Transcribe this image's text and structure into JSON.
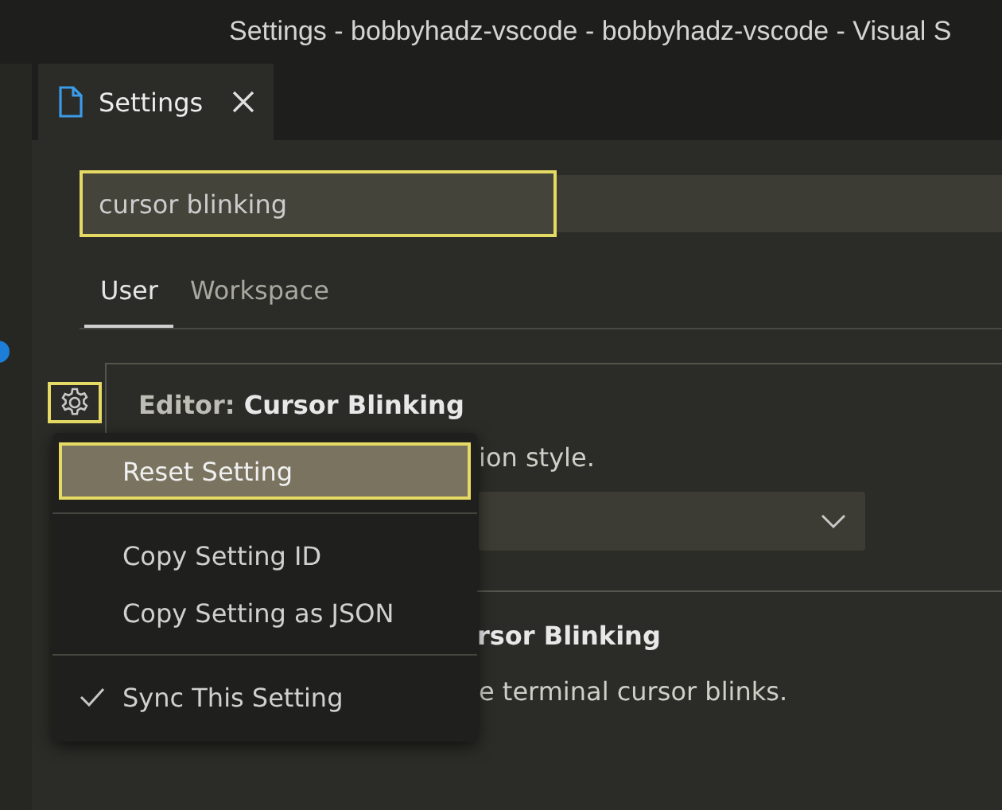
{
  "window": {
    "title": "Settings - bobbyhadz-vscode - bobbyhadz-vscode - Visual S"
  },
  "tabs": [
    {
      "label": "Settings",
      "selected": true
    }
  ],
  "search": {
    "value": "cursor blinking"
  },
  "scope_tabs": [
    {
      "label": "User",
      "selected": true
    },
    {
      "label": "Workspace",
      "selected": false
    }
  ],
  "settings": [
    {
      "category": "Editor:",
      "title": "Cursor Blinking",
      "description": "ion style.",
      "focused": true,
      "dropdown": true
    },
    {
      "title": "rsor Blinking",
      "description": "e terminal cursor blinks.",
      "focused": false,
      "dropdown": false
    }
  ],
  "context_menu": {
    "items": [
      {
        "kind": "item",
        "label": "Reset Setting",
        "selected": true,
        "checked": false
      },
      {
        "kind": "separator"
      },
      {
        "kind": "item",
        "label": "Copy Setting ID",
        "selected": false,
        "checked": false
      },
      {
        "kind": "item",
        "label": "Copy Setting as JSON",
        "selected": false,
        "checked": false
      },
      {
        "kind": "separator"
      },
      {
        "kind": "item",
        "label": "Sync This Setting",
        "selected": false,
        "checked": true
      }
    ]
  }
}
